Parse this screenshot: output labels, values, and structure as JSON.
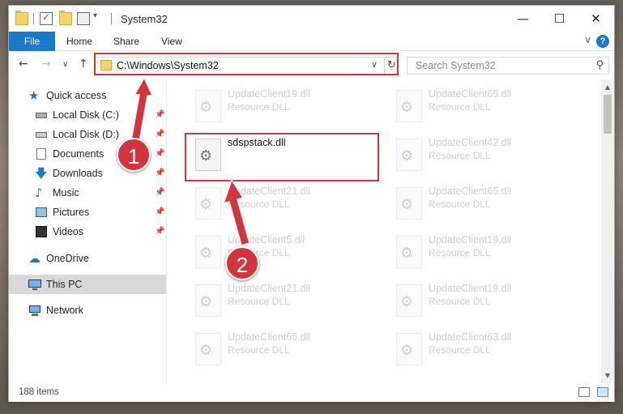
{
  "window": {
    "title": "System32",
    "controls": {
      "minimize": "—",
      "maximize": "☐",
      "close": "✕"
    }
  },
  "ribbon": {
    "tabs": [
      "File",
      "Home",
      "Share",
      "View"
    ],
    "help": "?",
    "collapse": "∨"
  },
  "nav": {
    "back": "←",
    "forward": "→",
    "recent": "∨",
    "up": "↑",
    "address": "C:\\Windows\\System32",
    "search_placeholder": "Search System32"
  },
  "sidebar": {
    "items": [
      {
        "label": "Quick access",
        "icon": "star-icon",
        "pinned": false
      },
      {
        "label": "Local Disk (C:)",
        "icon": "drive-icon",
        "pinned": true
      },
      {
        "label": "Local Disk (D:)",
        "icon": "drive-icon",
        "pinned": true
      },
      {
        "label": "Documents",
        "icon": "documents-icon",
        "pinned": true
      },
      {
        "label": "Downloads",
        "icon": "download-icon",
        "pinned": true
      },
      {
        "label": "Music",
        "icon": "music-icon",
        "pinned": true
      },
      {
        "label": "Pictures",
        "icon": "pictures-icon",
        "pinned": true
      },
      {
        "label": "Videos",
        "icon": "videos-icon",
        "pinned": true
      },
      {
        "label": "OneDrive",
        "icon": "onedrive-icon",
        "pinned": false
      },
      {
        "label": "This PC",
        "icon": "computer-icon",
        "pinned": false,
        "selected": true
      },
      {
        "label": "Network",
        "icon": "network-icon",
        "pinned": false
      }
    ]
  },
  "files": [
    {
      "name": "UpdateClient19.dll",
      "type": "Resource DLL",
      "faded": true
    },
    {
      "name": "UpdateClient65.dll",
      "type": "Resource DLL",
      "faded": true
    },
    {
      "name": "sdspstack.dll",
      "type": "",
      "faded": false
    },
    {
      "name": "UpdateClient42.dll",
      "type": "Resource DLL",
      "faded": true
    },
    {
      "name": "UpdateClient21.dll",
      "type": "Resource DLL",
      "faded": true
    },
    {
      "name": "UpdateClient65.dll",
      "type": "Resource DLL",
      "faded": true
    },
    {
      "name": "UpdateClient5.dll",
      "type": "Resource DLL",
      "faded": true
    },
    {
      "name": "UpdateClient19.dll",
      "type": "Resource DLL",
      "faded": true
    },
    {
      "name": "UpdateClient21.dll",
      "type": "Resource DLL",
      "faded": true
    },
    {
      "name": "UpdateClient19.dll",
      "type": "Resource DLL",
      "faded": true
    },
    {
      "name": "UpdateClient65.dll",
      "type": "Resource DLL",
      "faded": true
    },
    {
      "name": "UpdateClient63.dll",
      "type": "Resource DLL",
      "faded": true
    }
  ],
  "status": {
    "count": "188 items"
  },
  "callouts": {
    "step1": "1",
    "step2": "2"
  },
  "colors": {
    "accent": "#1979ca",
    "highlight": "#d4343c"
  }
}
